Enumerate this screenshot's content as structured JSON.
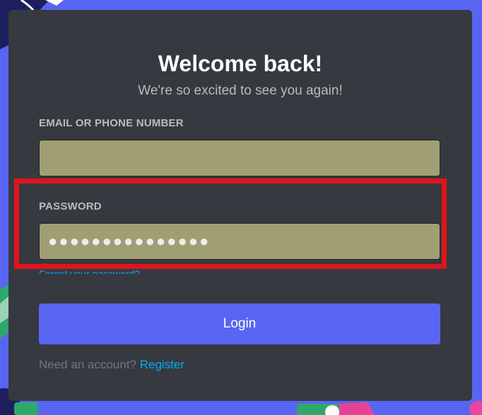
{
  "login": {
    "title": "Welcome back!",
    "subtitle": "We're so excited to see you again!",
    "email_label": "EMAIL OR PHONE NUMBER",
    "email_value": "",
    "password_label": "PASSWORD",
    "password_masked": "●●●●●●●●●●●●●●●",
    "forgot_link": "Forgot your password?",
    "login_button": "Login",
    "need_account": "Need an account?",
    "register_link": "Register"
  },
  "colors": {
    "background": "#5865f2",
    "card": "#36393f",
    "input_fill": "#a09f73",
    "accent": "#5865f2",
    "link": "#00aff4",
    "highlight_box": "#e0141c"
  }
}
